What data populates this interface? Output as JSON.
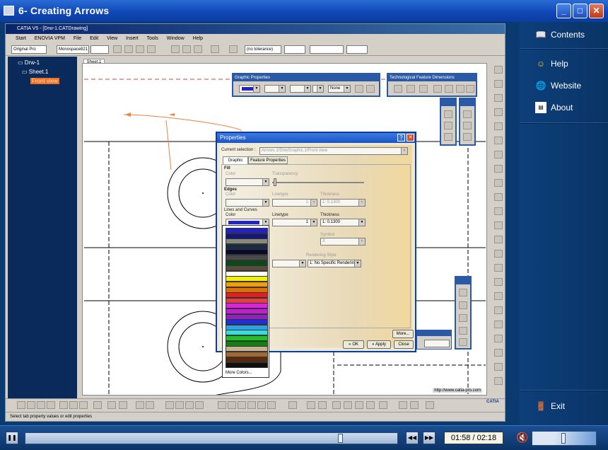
{
  "window": {
    "title": "6- Creating Arrows",
    "min": "_",
    "max": "□",
    "close": "✕"
  },
  "side": {
    "contents": "Contents",
    "help": "Help",
    "website": "Website",
    "about": "About",
    "exit": "Exit"
  },
  "catia": {
    "title": "CATIA V5 - [Drw-1.CATDrawing]",
    "menu": [
      "Start",
      "ENOVIA VPM",
      "File",
      "Edit",
      "View",
      "Insert",
      "Tools",
      "Window",
      "Help"
    ],
    "style_select": "Original Pro",
    "font_select": "Monospace821",
    "tolerance_select": "(no tolerance)",
    "sheet_tab": "Sheet.1",
    "status": "Select tab property values or edit properties",
    "url": "http://www.catia-pro.com",
    "tree": {
      "root": "Drw-1",
      "sheet": "Sheet.1",
      "view": "Front view"
    }
  },
  "graphic_props": {
    "title": "Graphic Properties",
    "none": "None"
  },
  "tech_dims": {
    "title": "Technological Feature Dimensions"
  },
  "props": {
    "title": "Properties",
    "current_selection_label": "Current selection :",
    "current_selection": "Arrows.1/Drw/Graphic.1/Front view",
    "tabs": [
      "Graphic",
      "Feature Properties"
    ],
    "fill": "Fill",
    "color": "Color",
    "transparency": "Transparency",
    "edges": "Edges",
    "linetype": "Linetype",
    "thickness": "Thickness",
    "thickness_val": "1: 0.1300",
    "lines_curves": "Lines and Curves",
    "linetype_val": "1",
    "symbol": "Symbol",
    "symbol_val": "X",
    "rendering_style": "Rendering Style",
    "rendering_val": "1: No Specific Renderin",
    "more": "More...",
    "ok": "OK",
    "apply": "Apply",
    "close": "Close"
  },
  "color_list": {
    "swatches": [
      "#2323c8",
      "#16167a",
      "#8a8a7a",
      "#1a2a40",
      "#0a0a2a",
      "#4a4a4a",
      "#0a4a1a",
      "#5a4a3a",
      "#ffffff",
      "#f2f200",
      "#f0a000",
      "#e07000",
      "#e02020",
      "#e04040",
      "#e020e0",
      "#c020d0",
      "#9020c0",
      "#2030d0",
      "#30a0e0",
      "#30e0e0",
      "#20c020",
      "#108010",
      "#c8b090",
      "#9a6a3a",
      "#5a2a0a",
      "#101010"
    ],
    "more_colors": "More Colors..."
  },
  "player": {
    "time": "01:58 / 02:18",
    "progress": 0.855,
    "volume": 0.5
  }
}
